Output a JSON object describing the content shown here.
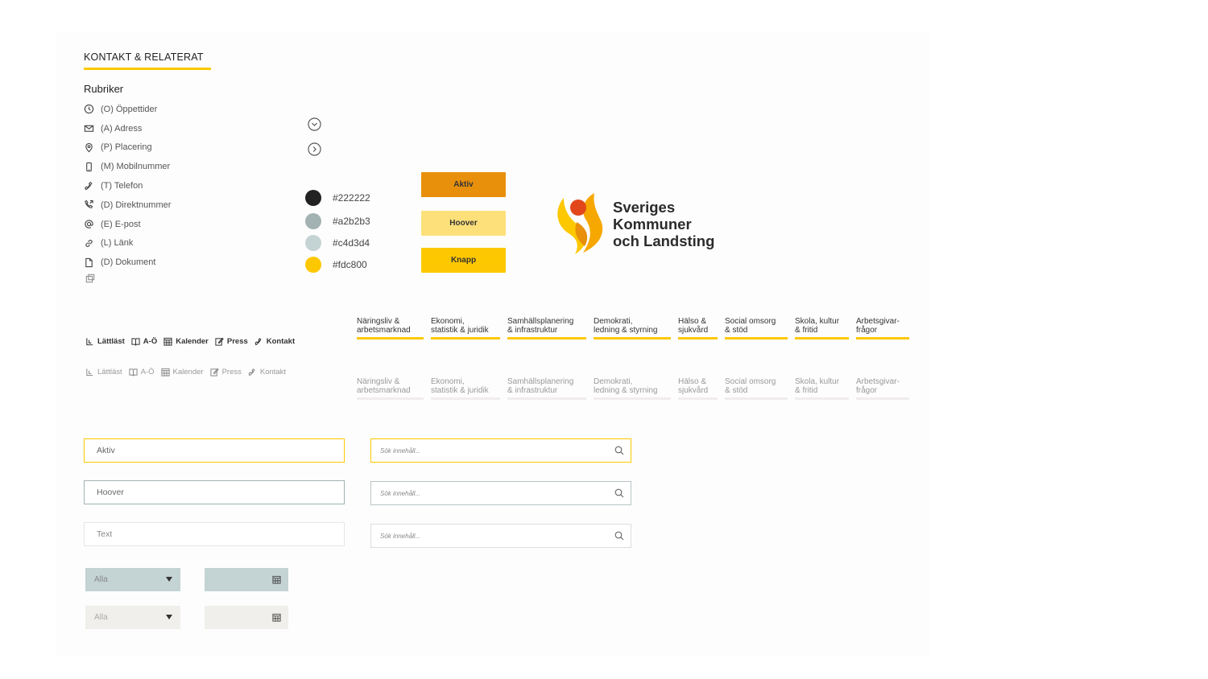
{
  "header": {
    "title": "KONTAKT & RELATERAT",
    "subtitle": "Rubriker"
  },
  "contact_items": [
    {
      "label": "(O) Öppettider",
      "icon": "clock-icon"
    },
    {
      "label": "(A) Adress",
      "icon": "envelope-icon"
    },
    {
      "label": "(P) Placering",
      "icon": "map-pin-icon"
    },
    {
      "label": "(M) Mobilnummer",
      "icon": "mobile-phone-icon"
    },
    {
      "label": "(T) Telefon",
      "icon": "phone-icon"
    },
    {
      "label": "(D) Direktnummer",
      "icon": "phone-forward-icon"
    },
    {
      "label": "(E) E-post",
      "icon": "at-sign-icon"
    },
    {
      "label": "(L) Länk",
      "icon": "link-icon"
    },
    {
      "label": "(D) Dokument",
      "icon": "document-icon"
    }
  ],
  "colors": [
    {
      "hex": "#222222",
      "label": "#222222"
    },
    {
      "hex": "#a2b2b3",
      "label": "#a2b2b3"
    },
    {
      "hex": "#c4d3d4",
      "label": "#c4d3d4"
    },
    {
      "hex": "#fdc800",
      "label": "#fdc800"
    }
  ],
  "buttons": {
    "active": {
      "label": "Aktiv",
      "bg": "#e8900c",
      "color": "#333333"
    },
    "hover": {
      "label": "Hoover",
      "bg": "#fde07a",
      "color": "#333333"
    },
    "default": {
      "label": "Knapp",
      "bg": "#fdc800",
      "color": "#333333"
    }
  },
  "logo": {
    "lines": [
      "Sveriges",
      "Kommuner",
      "och Landsting"
    ]
  },
  "utility_links": [
    {
      "label": "Lättläst",
      "icon": "easy-read-icon"
    },
    {
      "label": "A-Ö",
      "icon": "book-icon"
    },
    {
      "label": "Kalender",
      "icon": "calendar-icon"
    },
    {
      "label": "Press",
      "icon": "edit-icon"
    },
    {
      "label": "Kontakt",
      "icon": "phone-icon"
    }
  ],
  "nav_items": [
    "Näringsliv &\narbetsmarknad",
    "Ekonomi,\nstatistik & juridik",
    "Samhällsplanering\n& infrastruktur",
    "Demokrati,\nledning & styrning",
    "Hälso &\nsjukvård",
    "Social omsorg\n& stöd",
    "Skola, kultur\n& fritid",
    "Arbetsgivar-\nfrågor"
  ],
  "inputs": {
    "active": "Aktiv",
    "hover": "Hoover",
    "text": "Text",
    "search_placeholder": "Sök innehåll..."
  },
  "selects": {
    "value": "Alla"
  },
  "select_colors": {
    "active_bg": "#c4d3d4",
    "inactive_bg": "#f0efeb"
  }
}
